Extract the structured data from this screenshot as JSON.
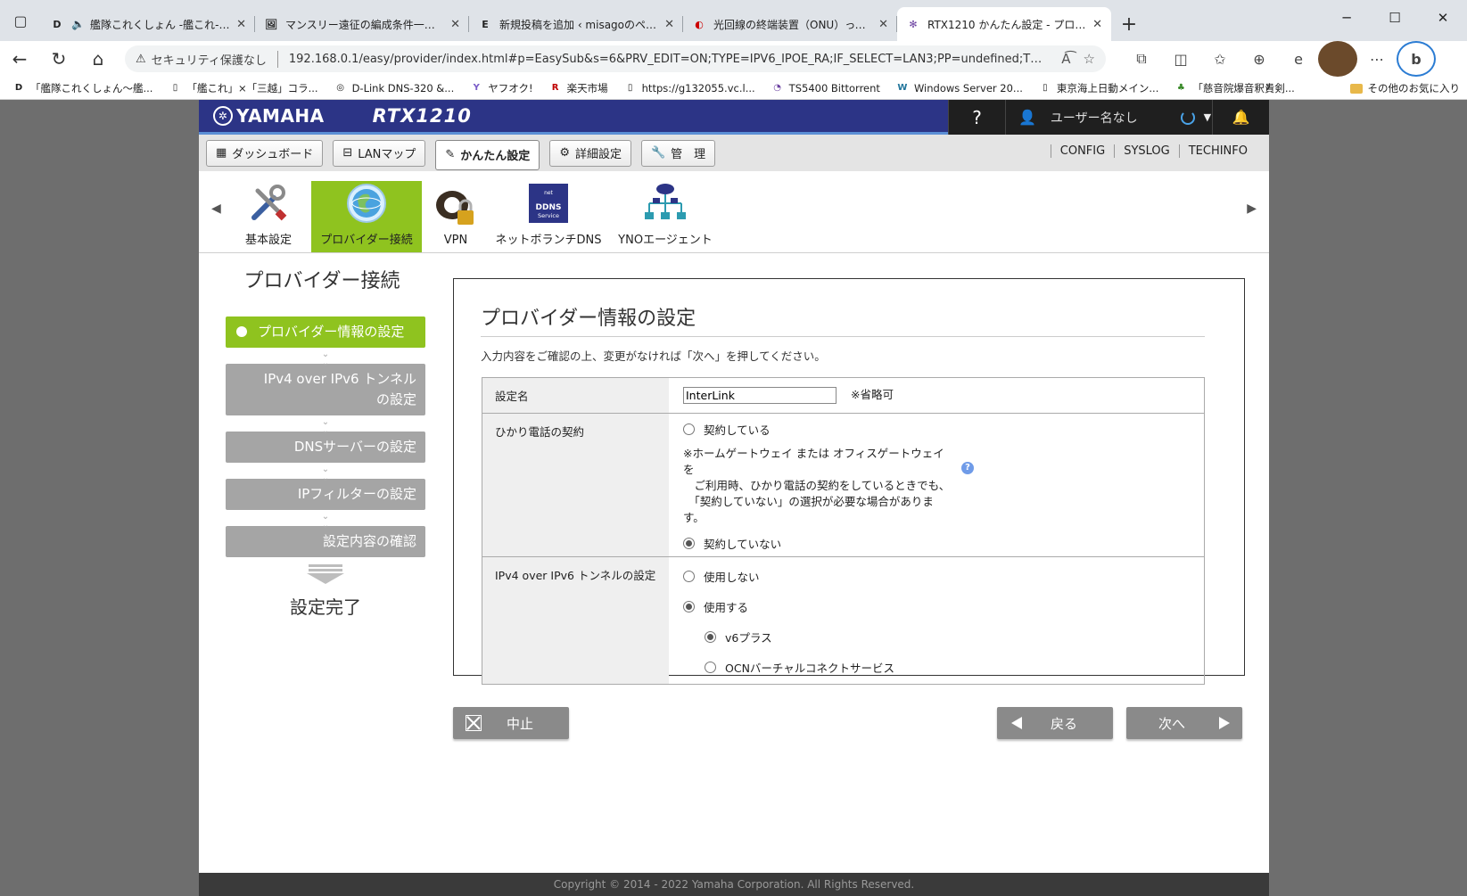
{
  "browser": {
    "tabs": [
      {
        "favicon": "D",
        "title": "艦隊これくしょん -艦これ- - オン",
        "audio": true
      },
      {
        "favicon": "🖼",
        "title": "マンスリー遠征の編成条件一覧と編"
      },
      {
        "favicon": "E",
        "title": "新規投稿を追加 ‹ misagoのページ -"
      },
      {
        "favicon": "◐",
        "title": "光回線の終端装置（ONU）って何"
      },
      {
        "favicon": "✻",
        "title": "RTX1210 かんたん設定 - プロバイダー",
        "active": true
      }
    ],
    "security_label": "セキュリティ保護なし",
    "url": "192.168.0.1/easy/provider/index.html#p=EasySub&s=6&PRV_EDIT=ON;TYPE=IPV6_IPOE_RA;IF_SELECT=LAN3;PP=undefined;TUNNEL_NU...",
    "bookmarks": [
      {
        "icon": "D",
        "label": "「艦隊これくしょん～艦..."
      },
      {
        "icon": "▯",
        "label": "「艦これ」×「三越」コラ..."
      },
      {
        "icon": "◎",
        "label": "D-Link DNS-320 &..."
      },
      {
        "icon": "Y",
        "label": "ヤフオク!"
      },
      {
        "icon": "R",
        "label": "楽天市場"
      },
      {
        "icon": "▯",
        "label": "https://g132055.vc.l..."
      },
      {
        "icon": "◔",
        "label": "TS5400 Bittorrent"
      },
      {
        "icon": "W",
        "label": "Windows Server 20..."
      },
      {
        "icon": "▯",
        "label": "東京海上日動メイン..."
      },
      {
        "icon": "♣",
        "label": "「慈音院爆音釈貴剣..."
      }
    ],
    "other_bookmarks": "その他のお気に入り"
  },
  "header": {
    "brand": "YAMAHA",
    "model": "RTX1210",
    "help": "?",
    "user": "ユーザー名なし"
  },
  "menu": {
    "items": [
      {
        "icon": "▦",
        "label": "ダッシュボード"
      },
      {
        "icon": "⊟",
        "label": "LANマップ"
      },
      {
        "icon": "✎",
        "label": "かんたん設定",
        "active": true
      },
      {
        "icon": "⚙",
        "label": "詳細設定"
      },
      {
        "icon": "🔧",
        "label": "管　理"
      }
    ],
    "links": [
      "CONFIG",
      "SYSLOG",
      "TECHINFO"
    ]
  },
  "icons": [
    {
      "label": "基本設定"
    },
    {
      "label": "プロバイダー接続",
      "selected": true
    },
    {
      "label": "VPN"
    },
    {
      "label": "ネットボランチDNS",
      "badge": "DDNS Service"
    },
    {
      "label": "YNOエージェント"
    }
  ],
  "steps": {
    "title": "プロバイダー接続",
    "items": [
      "プロバイダー情報の設定",
      "IPv4 over IPv6 トンネル\nの設定",
      "DNSサーバーの設定",
      "IPフィルターの設定",
      "設定内容の確認"
    ],
    "done": "設定完了"
  },
  "form": {
    "title": "プロバイダー情報の設定",
    "description": "入力内容をご確認の上、変更がなければ「次へ」を押してください。",
    "name_label": "設定名",
    "name_value": "InterLink",
    "name_hint": "※省略可",
    "phone_label": "ひかり電話の契約",
    "phone_yes": "契約している",
    "phone_note": "※ホームゲートウェイ または オフィスゲートウェイ を\n　ご利用時、ひかり電話の契約をしているときでも、\n　「契約していない」の選択が必要な場合があります。",
    "phone_no": "契約していない",
    "tunnel_label": "IPv4 over IPv6 トンネルの設定",
    "tunnel_off": "使用しない",
    "tunnel_on": "使用する",
    "tunnel_v6plus": "v6プラス",
    "tunnel_ocn": "OCNバーチャルコネクトサービス"
  },
  "buttons": {
    "cancel": "中止",
    "back": "戻る",
    "next": "次へ"
  },
  "footer": "Copyright © 2014 - 2022 Yamaha Corporation. All Rights Reserved.",
  "colors": {
    "accent_green": "#8fc31f",
    "header_blue": "#2c3486",
    "step_gray": "#a5a5a5"
  }
}
